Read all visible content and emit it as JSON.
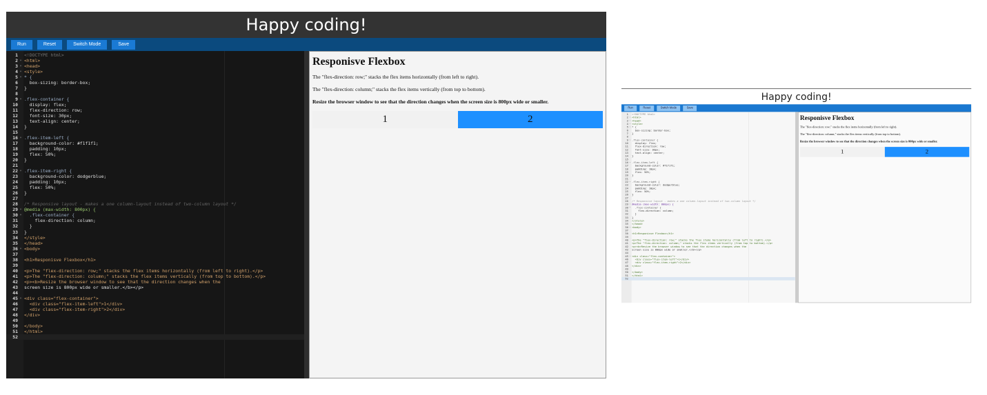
{
  "header": {
    "title": "Happy coding!"
  },
  "toolbar": {
    "run": "Run",
    "reset": "Reset",
    "switch_mode": "Switch Mode",
    "save": "Save"
  },
  "editor": {
    "fold_lines": [
      2,
      3,
      4,
      5,
      9,
      16,
      22,
      29,
      30,
      36,
      45
    ],
    "active_line": 52,
    "lines": [
      "<!DOCTYPE html>",
      "<html>",
      "<head>",
      "<style>",
      "* {",
      "  box-sizing: border-box;",
      "}",
      "",
      ".flex-container {",
      "  display: flex;",
      "  flex-direction: row;",
      "  font-size: 30px;",
      "  text-align: center;",
      "}",
      "",
      ".flex-item-left {",
      "  background-color: #f1f1f1;",
      "  padding: 10px;",
      "  flex: 50%;",
      "}",
      "",
      ".flex-item-right {",
      "  background-color: dodgerblue;",
      "  padding: 10px;",
      "  flex: 50%;",
      "}",
      "",
      "/* Responsive layout - makes a one column-layout instead of two-column layout */",
      "@media (max-width: 800px) {",
      "  .flex-container {",
      "    flex-direction: column;",
      "  }",
      "}",
      "</style>",
      "</head>",
      "<body>",
      "",
      "<h1>Responisve Flexbox</h1>",
      "",
      "<p>The \"flex-direction: row;\" stacks the flex items horizontally (from left to right).</p>",
      "<p>The \"flex-direction: column;\" stacks the flex items vertically (from top to bottom).</p>",
      "<p><b>Resize the browser window to see that the direction changes when the",
      "screen size is 800px wide or smaller.</b></p>",
      "",
      "<div class=\"flex-container\">",
      "  <div class=\"flex-item-left\">1</div>",
      "  <div class=\"flex-item-right\">2</div>",
      "</div>",
      "",
      "</body>",
      "</html>",
      ""
    ]
  },
  "preview": {
    "heading": "Responisve Flexbox",
    "p1": "The \"flex-direction: row;\" stacks the flex items horizontally (from left to right).",
    "p2": "The \"flex-direction: column;\" stacks the flex items vertically (from top to bottom).",
    "p3": "Resize the browser window to see that the direction changes when the screen size is 800px wide or smaller.",
    "item1": "1",
    "item2": "2"
  },
  "colors": {
    "toolbar_dark": "#0b4a7e",
    "toolbar_light": "#1a78d0",
    "button": "#1a7ad4",
    "flex_right": "#1e90ff",
    "flex_left": "#f1f1f1"
  }
}
